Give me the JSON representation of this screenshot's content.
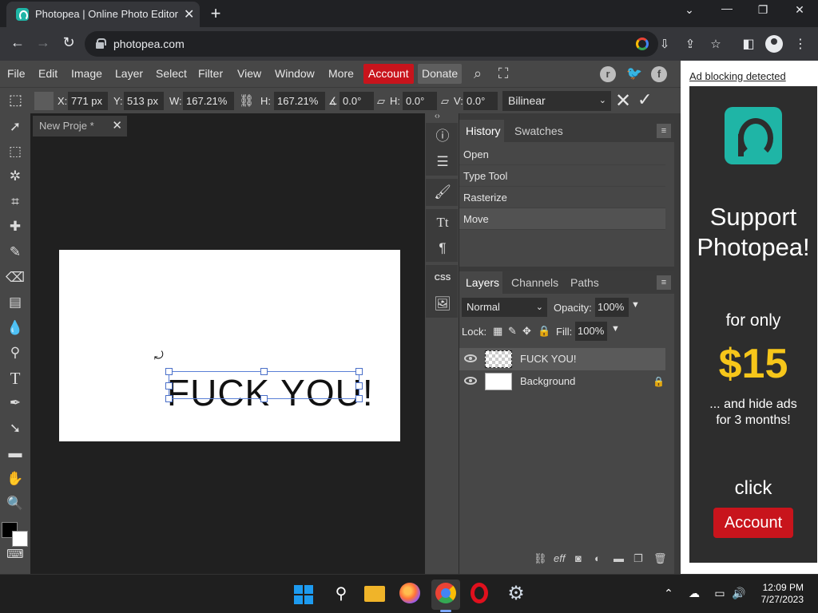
{
  "browser": {
    "tab_title": "Photopea | Online Photo Editor",
    "url": "photopea.com"
  },
  "menu": {
    "items": [
      "File",
      "Edit",
      "Image",
      "Layer",
      "Select",
      "Filter",
      "View",
      "Window",
      "More"
    ],
    "account": "Account",
    "donate": "Donate"
  },
  "options": {
    "x_label": "X:",
    "x_value": "771 px",
    "y_label": "Y:",
    "y_value": "513 px",
    "w_label": "W:",
    "w_value": "167.21%",
    "h_label": "H:",
    "h_value": "167.21%",
    "angle_value": "0.0°",
    "skew_h_label": "H:",
    "skew_h_value": "0.0°",
    "skew_v_label": "V:",
    "skew_v_value": "0.0°",
    "interpolation": "Bilinear"
  },
  "document": {
    "tab_title": "New Proje  *",
    "canvas_text": "FUCK YOU!"
  },
  "history": {
    "tabs": [
      "History",
      "Swatches"
    ],
    "items": [
      "Open",
      "Type Tool",
      "Rasterize",
      "Move"
    ],
    "selected_index": 3
  },
  "layers": {
    "tabs": [
      "Layers",
      "Channels",
      "Paths"
    ],
    "blend_mode": "Normal",
    "opacity_label": "Opacity:",
    "opacity_value": "100%",
    "lock_label": "Lock:",
    "fill_label": "Fill:",
    "fill_value": "100%",
    "items": [
      {
        "name": "FUCK YOU!",
        "selected": true
      },
      {
        "name": "Background",
        "selected": false
      }
    ]
  },
  "ad": {
    "blocking_notice": "Ad blocking detected",
    "headline_1": "Support",
    "headline_2": "Photopea!",
    "for_only": "for only",
    "price": "$15",
    "hide_1": "... and hide ads",
    "hide_2": "for 3 months!",
    "click": "click",
    "button": "Account"
  },
  "taskbar": {
    "time": "12:09 PM",
    "date": "7/27/2023"
  },
  "colors": {
    "account_red": "#c8141c",
    "photopea_teal": "#1fb5a6",
    "price_yellow": "#f6c61a"
  }
}
